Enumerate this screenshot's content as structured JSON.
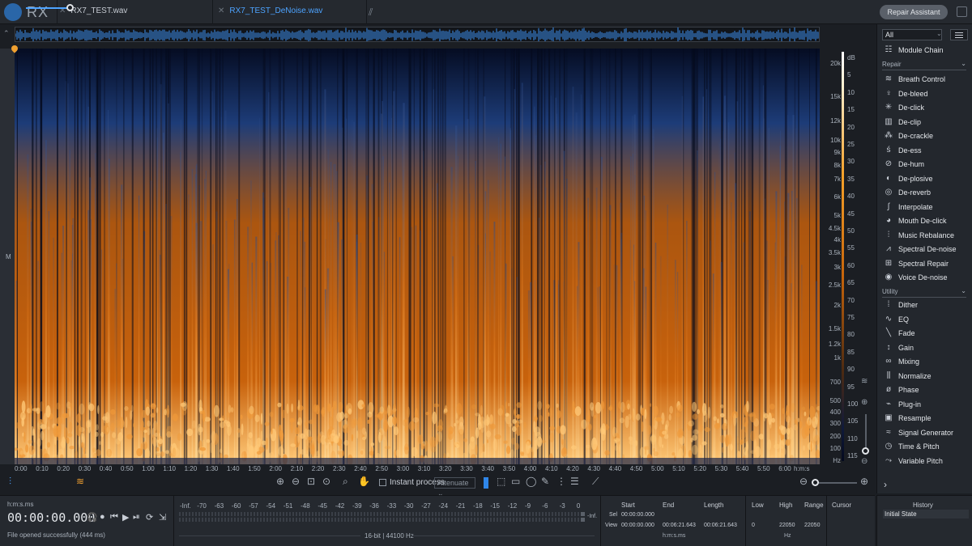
{
  "app": {
    "logo_text": "RX"
  },
  "tabs": [
    {
      "label": "RX7_TEST.wav",
      "active": false
    },
    {
      "label": "RX7_TEST_DeNoise.wav",
      "active": true
    }
  ],
  "repair_assistant_label": "Repair Assistant",
  "track_label": "M",
  "spectrogram": {
    "freq_labels": [
      "20k",
      "15k",
      "12k",
      "10k",
      "9k",
      "8k",
      "7k",
      "6k",
      "5k",
      "4.5k",
      "4k",
      "3.5k",
      "3k",
      "2.5k",
      "2k",
      "1.5k",
      "1.2k",
      "1k",
      "700",
      "500",
      "400",
      "300",
      "200",
      "100",
      "Hz"
    ],
    "db_labels": [
      "dB",
      "5",
      "10",
      "15",
      "20",
      "25",
      "30",
      "35",
      "40",
      "45",
      "50",
      "55",
      "60",
      "65",
      "70",
      "75",
      "80",
      "85",
      "90",
      "95",
      "100",
      "105",
      "110",
      "115"
    ],
    "time_labels": [
      "0:00",
      "0:10",
      "0:20",
      "0:30",
      "0:40",
      "0:50",
      "1:00",
      "1:10",
      "1:20",
      "1:30",
      "1:40",
      "1:50",
      "2:00",
      "2:10",
      "2:20",
      "2:30",
      "2:40",
      "2:50",
      "3:00",
      "3:10",
      "3:20",
      "3:30",
      "3:40",
      "3:50",
      "4:00",
      "4:10",
      "4:20",
      "4:30",
      "4:40",
      "4:50",
      "5:00",
      "5:10",
      "5:20",
      "5:30",
      "5:40",
      "5:50",
      "6:00",
      "h:m:s"
    ],
    "colors": {
      "low": "#050c22",
      "mid": "#1d3c78",
      "warm": "#c8620c",
      "hot": "#ffc978"
    }
  },
  "toolbar": {
    "instant_process_label": "Instant process",
    "instant_process_checked": false,
    "mode_value": "Attenuate"
  },
  "transport": {
    "time_format": "h:m:s.ms",
    "timecode": "00:00:00.000",
    "status": "File opened successfully (444 ms)",
    "meter_scale": [
      "-Inf.",
      "-70",
      "-63",
      "-60",
      "-57",
      "-54",
      "-51",
      "-48",
      "-45",
      "-42",
      "-39",
      "-36",
      "-33",
      "-30",
      "-27",
      "-24",
      "-21",
      "-18",
      "-15",
      "-12",
      "-9",
      "-6",
      "-3",
      "0"
    ],
    "meter_inf": "-Inf.",
    "bit_info": "16-bit | 44100 Hz"
  },
  "selection": {
    "headers": {
      "start": "Start",
      "end": "End",
      "length": "Length",
      "low": "Low",
      "high": "High",
      "range": "Range",
      "cursor": "Cursor"
    },
    "sel_label": "Sel",
    "view_label": "View",
    "sel_start": "00:00:00.000",
    "view_start": "00:00:00.000",
    "view_end": "00:06:21.643",
    "view_length": "00:06:21.643",
    "low": "0",
    "high": "22050",
    "range": "22050",
    "time_unit": "h:m:s.ms",
    "freq_unit": "Hz"
  },
  "modules": {
    "filter_value": "All",
    "module_chain_label": "Module Chain",
    "repair_header": "Repair",
    "repair": [
      {
        "label": "Breath Control",
        "icon": "lungs-icon",
        "glyph": "≋"
      },
      {
        "label": "De-bleed",
        "icon": "mic-icon",
        "glyph": "♀"
      },
      {
        "label": "De-click",
        "icon": "click-icon",
        "glyph": "✳"
      },
      {
        "label": "De-clip",
        "icon": "clip-icon",
        "glyph": "▥"
      },
      {
        "label": "De-crackle",
        "icon": "crackle-icon",
        "glyph": "⁂"
      },
      {
        "label": "De-ess",
        "icon": "ess-icon",
        "glyph": "ś"
      },
      {
        "label": "De-hum",
        "icon": "hum-icon",
        "glyph": "⊘"
      },
      {
        "label": "De-plosive",
        "icon": "plosive-icon",
        "glyph": "◐"
      },
      {
        "label": "De-reverb",
        "icon": "reverb-icon",
        "glyph": "◎"
      },
      {
        "label": "Interpolate",
        "icon": "interpolate-icon",
        "glyph": "∫"
      },
      {
        "label": "Mouth De-click",
        "icon": "mouth-icon",
        "glyph": "◕"
      },
      {
        "label": "Music Rebalance",
        "icon": "rebalance-icon",
        "glyph": "⫶"
      },
      {
        "label": "Spectral De-noise",
        "icon": "spectral-denoise-icon",
        "glyph": "⩘"
      },
      {
        "label": "Spectral Repair",
        "icon": "spectral-repair-icon",
        "glyph": "⊞"
      },
      {
        "label": "Voice De-noise",
        "icon": "voice-icon",
        "glyph": "◉"
      }
    ],
    "utility_header": "Utility",
    "utility": [
      {
        "label": "Dither",
        "icon": "dither-icon",
        "glyph": "⁞"
      },
      {
        "label": "EQ",
        "icon": "eq-icon",
        "glyph": "∿"
      },
      {
        "label": "Fade",
        "icon": "fade-icon",
        "glyph": "╲"
      },
      {
        "label": "Gain",
        "icon": "gain-icon",
        "glyph": "↕"
      },
      {
        "label": "Mixing",
        "icon": "mixing-icon",
        "glyph": "∞"
      },
      {
        "label": "Normalize",
        "icon": "normalize-icon",
        "glyph": "⫼"
      },
      {
        "label": "Phase",
        "icon": "phase-icon",
        "glyph": "ø"
      },
      {
        "label": "Plug-in",
        "icon": "plugin-icon",
        "glyph": "⌁"
      },
      {
        "label": "Resample",
        "icon": "resample-icon",
        "glyph": "▣"
      },
      {
        "label": "Signal Generator",
        "icon": "signal-generator-icon",
        "glyph": "≈"
      },
      {
        "label": "Time & Pitch",
        "icon": "clock-icon",
        "glyph": "◷"
      },
      {
        "label": "Variable Pitch",
        "icon": "variable-pitch-icon",
        "glyph": "⤳"
      }
    ]
  },
  "history": {
    "title": "History",
    "items": [
      "Initial State"
    ]
  }
}
